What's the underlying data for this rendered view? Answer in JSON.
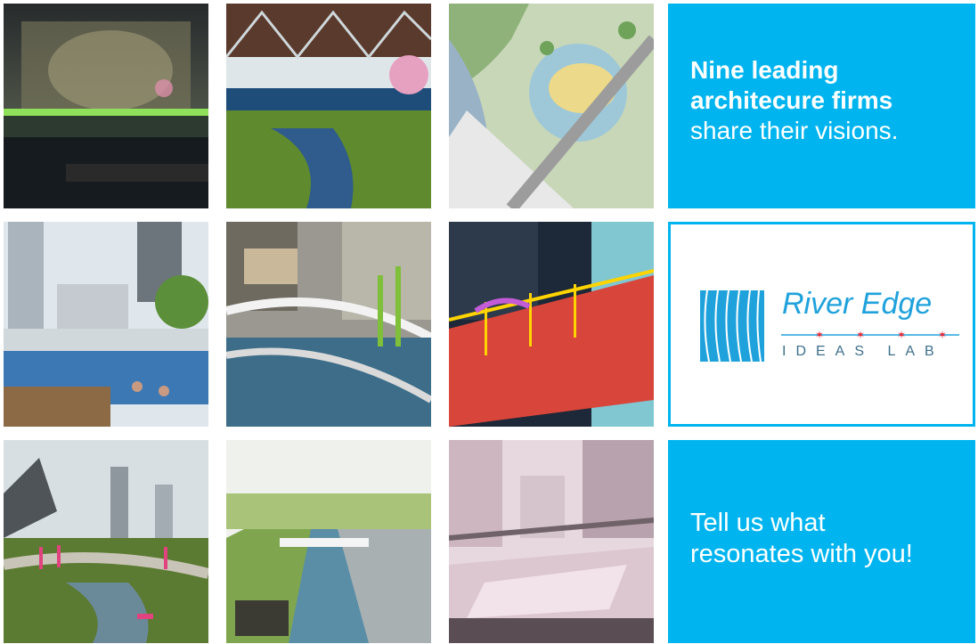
{
  "panels": {
    "headline_strong_1": "Nine leading",
    "headline_strong_2": "architecure firms",
    "headline_light": "share their visions.",
    "cta_line_1": "Tell us what",
    "cta_line_2": "resonates with you!"
  },
  "logo": {
    "title": "River Edge",
    "subtitle": "IDEAS LAB"
  },
  "colors": {
    "accent_blue": "#00b5ef",
    "logo_blue": "#1fa2dc",
    "star_red": "#e4202e"
  }
}
